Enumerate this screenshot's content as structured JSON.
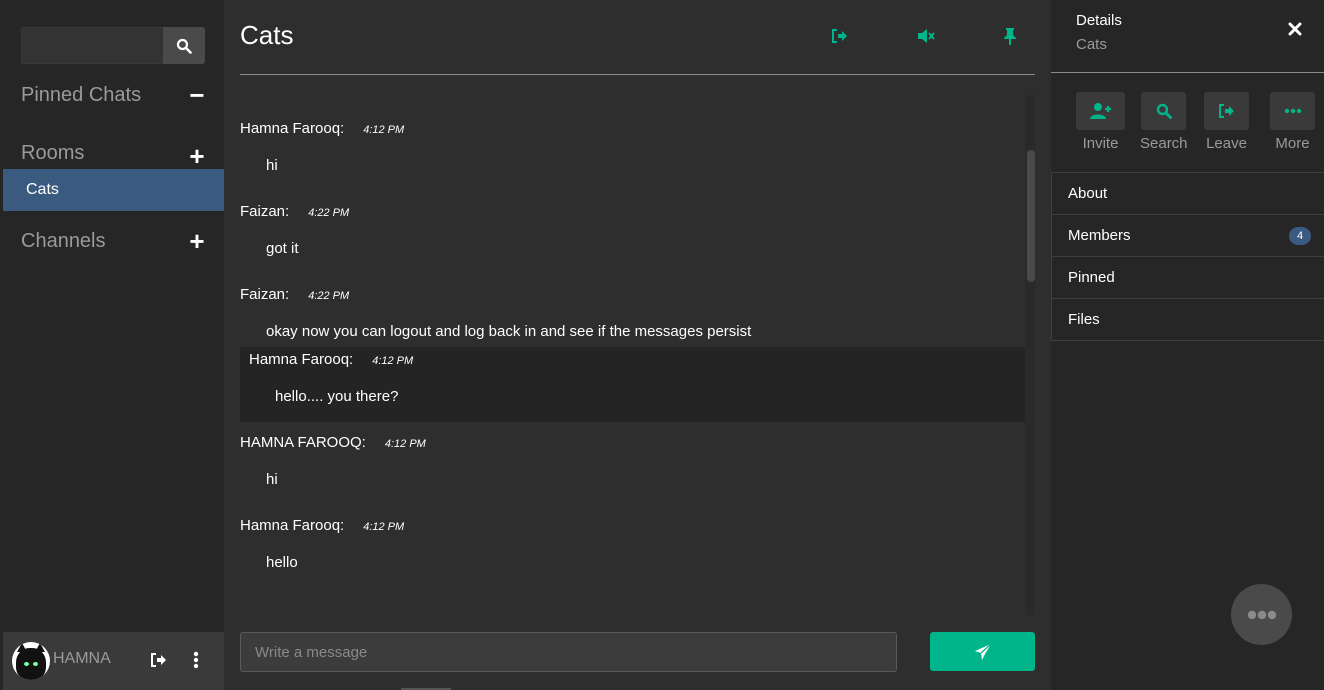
{
  "sidebar": {
    "search": {
      "placeholder": ""
    },
    "pinned_label": "Pinned Chats",
    "pinned_control": "−",
    "rooms_label": "Rooms",
    "rooms_control": "+",
    "rooms": [
      {
        "label": "Cats"
      }
    ],
    "channels_label": "Channels",
    "channels_control": "+",
    "user": {
      "name": "HAMNA"
    }
  },
  "chat": {
    "title": "Cats",
    "messages": [
      {
        "author": "Hamna Farooq:",
        "time": "4:12 PM",
        "text": "hi",
        "highlighted": false
      },
      {
        "author": "Faizan:",
        "time": "4:22 PM",
        "text": "got it",
        "highlighted": false
      },
      {
        "author": "Faizan:",
        "time": "4:22 PM",
        "text": "okay now you can logout and log back in and see if the messages persist",
        "highlighted": false
      },
      {
        "author": "Hamna Farooq:",
        "time": "4:12 PM",
        "text": "hello.... you there?",
        "highlighted": true
      },
      {
        "author": "HAMNA FAROOQ:",
        "time": "4:12 PM",
        "text": "hi",
        "highlighted": false
      },
      {
        "author": "Hamna Farooq:",
        "time": "4:12 PM",
        "text": "hello",
        "highlighted": false
      }
    ],
    "composer": {
      "placeholder": "Write a message"
    }
  },
  "details": {
    "title": "Details",
    "subtitle": "Cats",
    "actions": [
      {
        "label": "Invite",
        "icon": "user-plus-icon"
      },
      {
        "label": "Search",
        "icon": "search-icon"
      },
      {
        "label": "Leave",
        "icon": "leave-icon"
      },
      {
        "label": "More",
        "icon": "more-icon"
      }
    ],
    "menu": [
      {
        "label": "About"
      },
      {
        "label": "Members",
        "badge": "4"
      },
      {
        "label": "Pinned"
      },
      {
        "label": "Files"
      }
    ]
  },
  "colors": {
    "accent": "#00b589",
    "selected": "#3a5a80",
    "background": "#2e2e2e",
    "panel": "#262626"
  }
}
